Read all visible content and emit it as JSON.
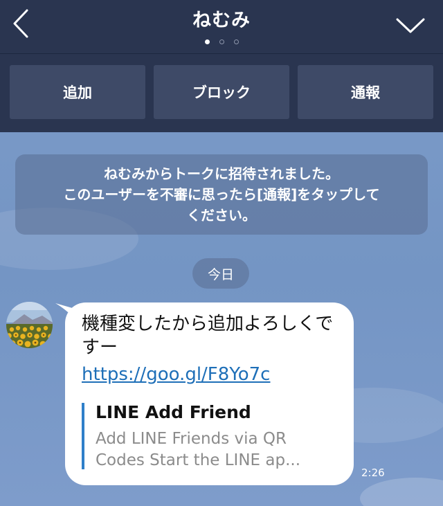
{
  "header": {
    "title": "ねむみ",
    "back_icon": "chevron-left-icon",
    "menu_icon": "chevron-down-icon",
    "page_indicator": {
      "total": 3,
      "active": 1
    },
    "actions": {
      "add": "追加",
      "block": "ブロック",
      "report": "通報"
    },
    "colors": {
      "background": "#2a3550",
      "button": "#3e4a67"
    }
  },
  "notice": {
    "line1": "ねむみからトークに招待されました。",
    "line2": "このユーザーを不審に思ったら[通報]をタップして",
    "line3": "ください。"
  },
  "date_label": "今日",
  "message": {
    "text": "機種変したから追加よろしくですー",
    "link": "https://goo.gl/F8Yo7c",
    "preview_title": "LINE Add Friend",
    "preview_desc_line1": "Add LINE Friends via QR",
    "preview_desc_line2": "Codes Start the LINE ap...",
    "time": "2:26",
    "colors": {
      "link": "#1e6fb8",
      "preview_bar": "#2f7fc9"
    }
  },
  "chat_background": "#7495c4"
}
